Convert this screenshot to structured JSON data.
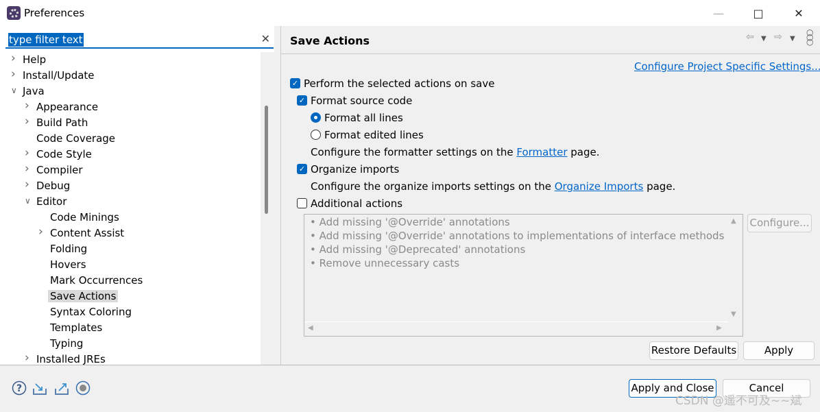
{
  "window": {
    "title": "Preferences",
    "app_icon": "eclipse-gear-icon",
    "controls": [
      "minimize",
      "maximize",
      "close"
    ]
  },
  "filter": {
    "value": "type filter text",
    "clear_icon": "clear-icon"
  },
  "tree": [
    {
      "label": "Help",
      "level": 0,
      "expander": "collapsed"
    },
    {
      "label": "Install/Update",
      "level": 0,
      "expander": "collapsed"
    },
    {
      "label": "Java",
      "level": 0,
      "expander": "expanded"
    },
    {
      "label": "Appearance",
      "level": 1,
      "expander": "collapsed"
    },
    {
      "label": "Build Path",
      "level": 1,
      "expander": "collapsed"
    },
    {
      "label": "Code Coverage",
      "level": 1,
      "expander": "none"
    },
    {
      "label": "Code Style",
      "level": 1,
      "expander": "collapsed"
    },
    {
      "label": "Compiler",
      "level": 1,
      "expander": "collapsed"
    },
    {
      "label": "Debug",
      "level": 1,
      "expander": "collapsed"
    },
    {
      "label": "Editor",
      "level": 1,
      "expander": "expanded"
    },
    {
      "label": "Code Minings",
      "level": 2,
      "expander": "none"
    },
    {
      "label": "Content Assist",
      "level": 2,
      "expander": "collapsed"
    },
    {
      "label": "Folding",
      "level": 2,
      "expander": "none"
    },
    {
      "label": "Hovers",
      "level": 2,
      "expander": "none"
    },
    {
      "label": "Mark Occurrences",
      "level": 2,
      "expander": "none"
    },
    {
      "label": "Save Actions",
      "level": 2,
      "expander": "none",
      "selected": true
    },
    {
      "label": "Syntax Coloring",
      "level": 2,
      "expander": "none"
    },
    {
      "label": "Templates",
      "level": 2,
      "expander": "none"
    },
    {
      "label": "Typing",
      "level": 2,
      "expander": "none"
    },
    {
      "label": "Installed JREs",
      "level": 1,
      "expander": "collapsed"
    }
  ],
  "page": {
    "title": "Save Actions",
    "configure_project_link": "Configure Project Specific Settings...",
    "perform_on_save": {
      "label": "Perform the selected actions on save",
      "checked": true
    },
    "format_source": {
      "label": "Format source code",
      "checked": true
    },
    "format_all": {
      "label": "Format all lines",
      "selected": true
    },
    "format_edited": {
      "label": "Format edited lines",
      "selected": false
    },
    "formatter_note": {
      "before": "Configure the formatter settings on the ",
      "link": "Formatter",
      "after": " page."
    },
    "organize_imports": {
      "label": "Organize imports",
      "checked": true
    },
    "organize_note": {
      "before": "Configure the organize imports settings on the ",
      "link": "Organize Imports",
      "after": " page."
    },
    "additional_actions": {
      "label": "Additional actions",
      "checked": false
    },
    "actions": [
      "Add missing '@Override' annotations",
      "Add missing '@Override' annotations to implementations of interface methods",
      "Add missing '@Deprecated' annotations",
      "Remove unnecessary casts"
    ],
    "configure_button": "Configure...",
    "restore_defaults": "Restore Defaults",
    "apply": "Apply"
  },
  "footer": {
    "apply_close": "Apply and Close",
    "cancel": "Cancel",
    "icons": [
      "help-icon",
      "import-icon",
      "export-icon",
      "record-icon"
    ]
  },
  "watermark": "CSDN @遥不可及~~斌"
}
